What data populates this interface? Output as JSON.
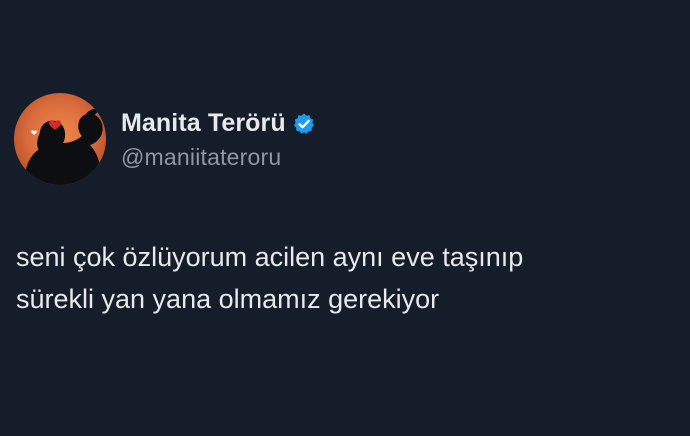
{
  "tweet": {
    "author": {
      "display_name": "Manita Terörü",
      "handle": "@maniitateroru",
      "verified_icon": "verified-badge-icon",
      "avatar_icon": "profile-photo"
    },
    "text_lines": [
      "seni çok özlüyorum acilen aynı eve taşınıp",
      "sürekli yan yana olmamız gerekiyor"
    ]
  },
  "colors": {
    "background": "#141d29",
    "primary_text": "#e7e9ea",
    "secondary_text": "#8b98a5",
    "verified_blue": "#1d9bf0",
    "avatar_orange": "#d96b3b"
  }
}
